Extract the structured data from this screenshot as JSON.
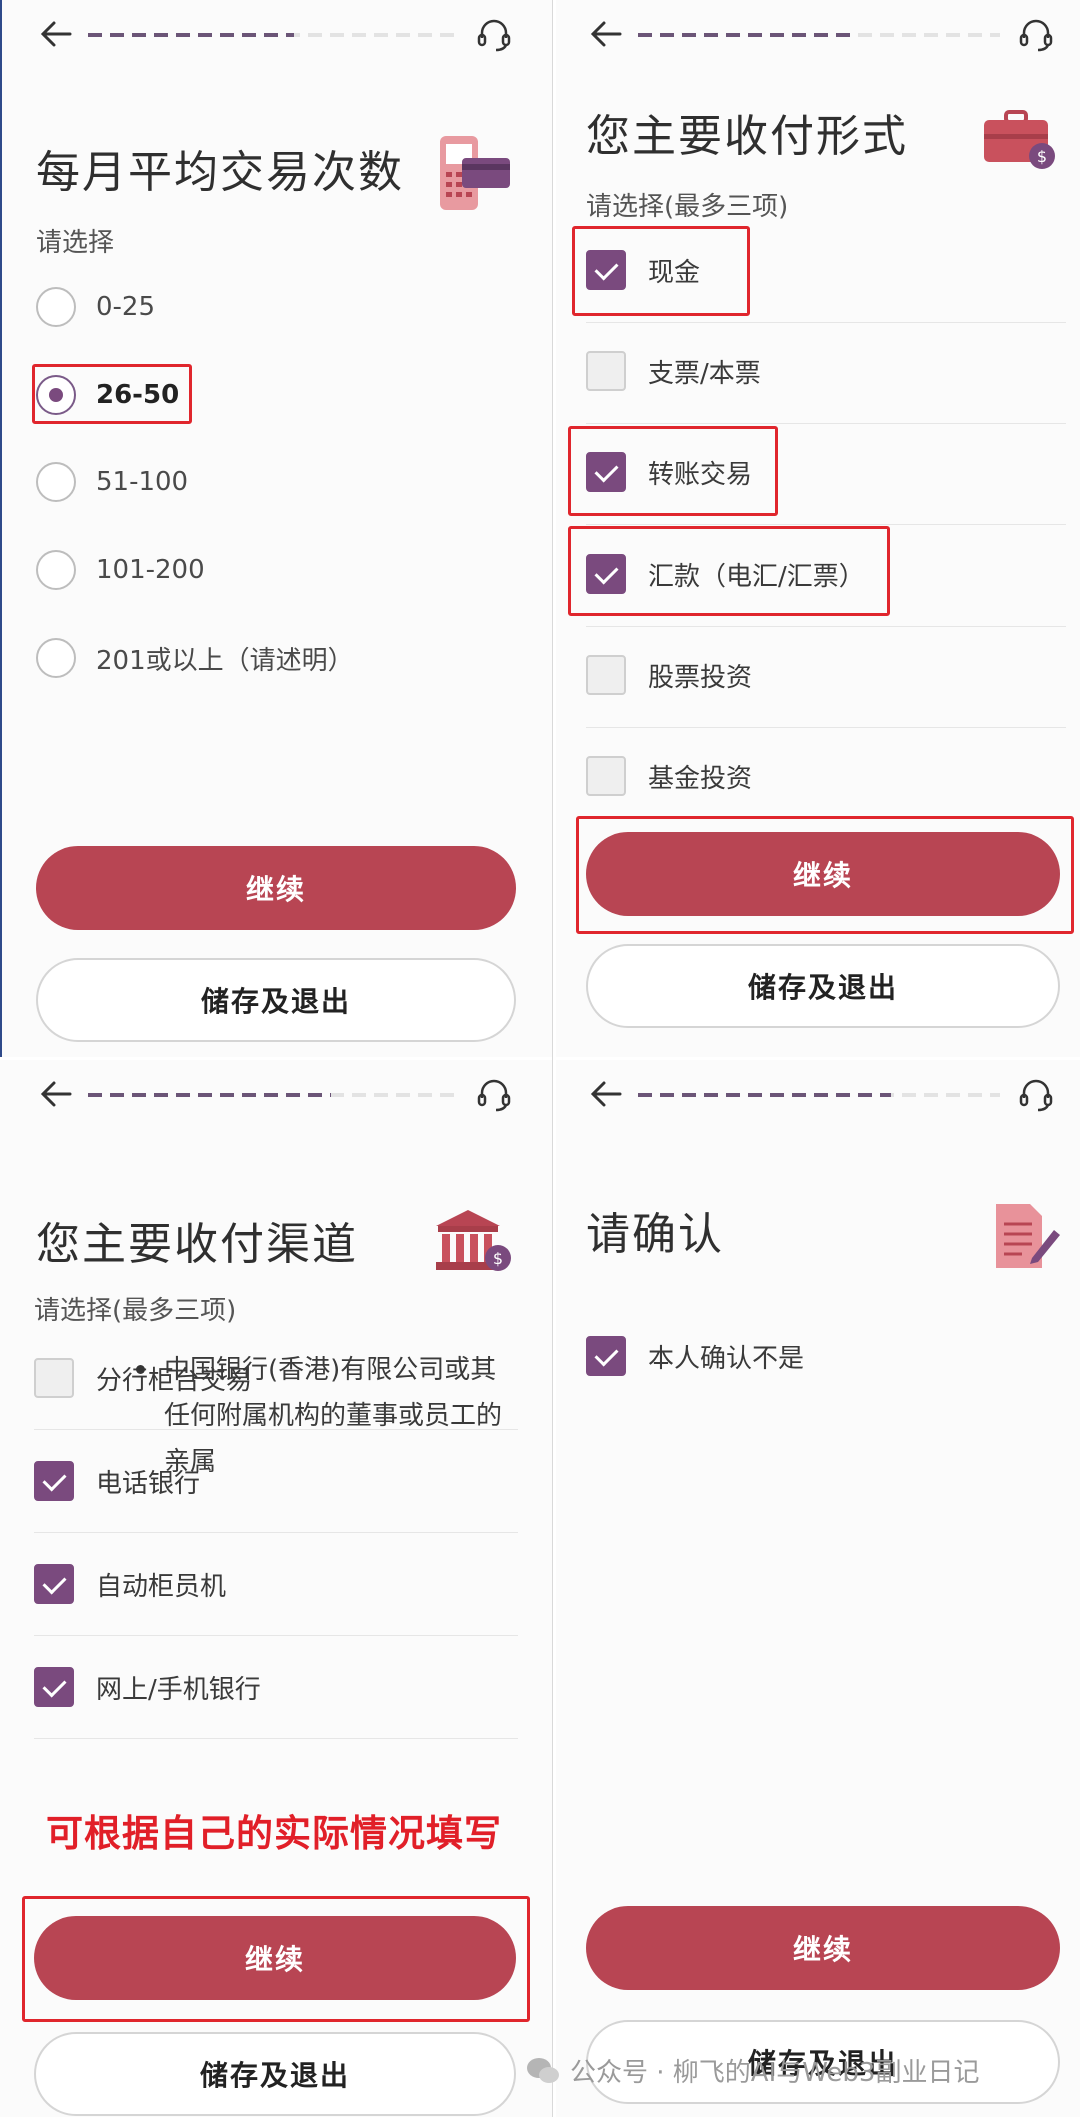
{
  "screen1": {
    "title": "每月平均交易次数",
    "subtitle": "请选择",
    "progress": 0.55,
    "options": [
      {
        "label": "0-25",
        "selected": false
      },
      {
        "label": "26-50",
        "selected": true
      },
      {
        "label": "51-100",
        "selected": false
      },
      {
        "label": "101-200",
        "selected": false
      },
      {
        "label": "201或以上（请述明）",
        "selected": false
      }
    ],
    "continue_label": "继续",
    "save_exit_label": "储存及退出",
    "illustration": "card-terminal-icon"
  },
  "screen2": {
    "title": "您主要收付形式",
    "subtitle": "请选择(最多三项)",
    "progress": 0.6,
    "options": [
      {
        "label": "现金",
        "checked": true
      },
      {
        "label": "支票/本票",
        "checked": false
      },
      {
        "label": "转账交易",
        "checked": true
      },
      {
        "label": "汇款（电汇/汇票）",
        "checked": true
      },
      {
        "label": "股票投资",
        "checked": false
      },
      {
        "label": "基金投资",
        "checked": false
      }
    ],
    "continue_label": "继续",
    "save_exit_label": "储存及退出",
    "illustration": "briefcase-money-icon"
  },
  "screen3": {
    "title": "您主要收付渠道",
    "subtitle": "请选择(最多三项)",
    "progress": 0.65,
    "options": [
      {
        "label": "分行柜台交易",
        "checked": false
      },
      {
        "label": "电话银行",
        "checked": true
      },
      {
        "label": "自动柜员机",
        "checked": true
      },
      {
        "label": "网上/手机银行",
        "checked": true
      }
    ],
    "annotation": "可根据自己的实际情况填写",
    "continue_label": "继续",
    "save_exit_label": "储存及退出",
    "illustration": "bank-building-icon"
  },
  "screen4": {
    "title": "请确认",
    "progress": 0.7,
    "confirm_label": "本人确认不是",
    "confirm_checked": true,
    "bullet": "中国银行(香港)有限公司或其任何附属机构的董事或员工的亲属",
    "continue_label": "继续",
    "save_exit_label": "储存及退出",
    "illustration": "document-pen-icon"
  },
  "watermark": "公众号 · 柳飞的AI与Web3副业日记",
  "colors": {
    "primary_button": "#b84553",
    "checkbox_checked": "#7a4a7e",
    "highlight_box": "#e0262d",
    "progress_done": "#6b5577"
  }
}
